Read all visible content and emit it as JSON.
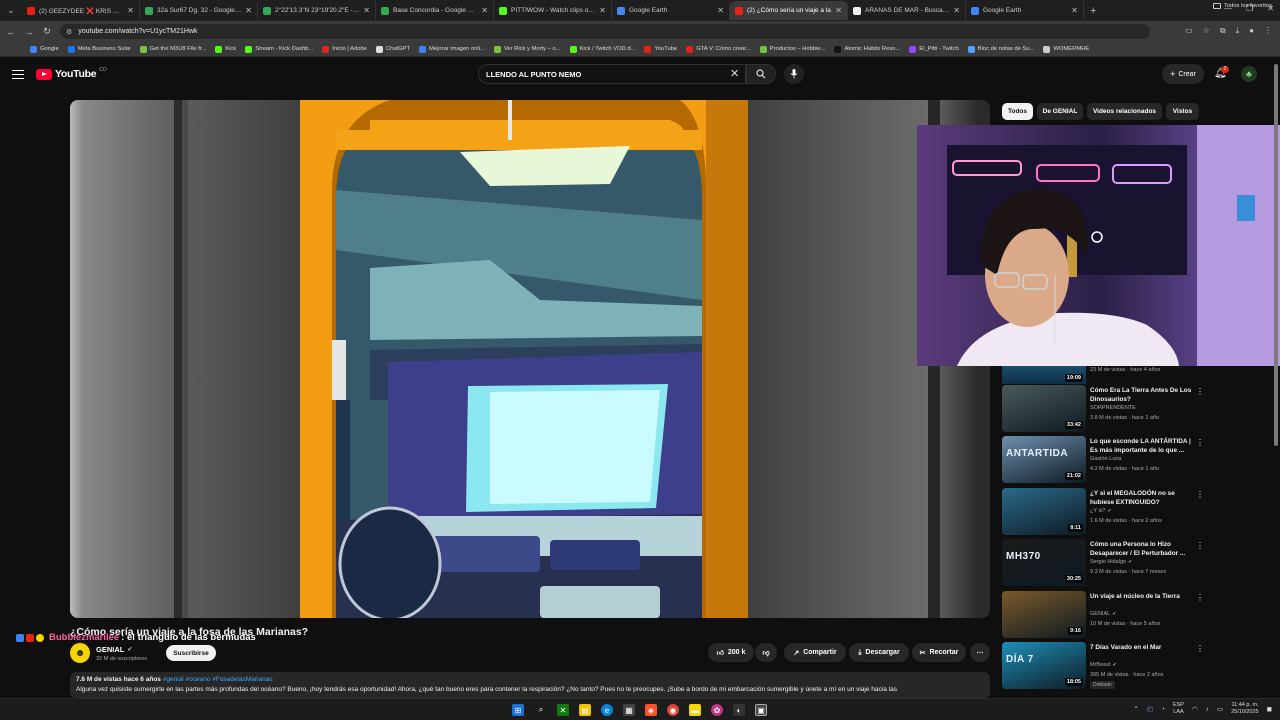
{
  "browser": {
    "tabs": [
      {
        "title": "(2) GEEZYDEE ❌ KRIS R - PAR",
        "color": "#e62117",
        "active": false
      },
      {
        "title": "32a Sur67 Dg. 32 - Google Ma",
        "color": "#34a853",
        "active": false
      },
      {
        "title": "2°22'13.3\"N 23°19'20.2\"E - Go",
        "color": "#34a853",
        "active": false
      },
      {
        "title": "Base Concordia - Google Maps",
        "color": "#34a853",
        "active": false
      },
      {
        "title": "PITTIWOW - Watch clips on Ki",
        "color": "#53fc18",
        "active": false
      },
      {
        "title": "Google Earth",
        "color": "#4285f4",
        "active": false
      },
      {
        "title": "(2) ¿Cómo sería un viaje a la",
        "color": "#e62117",
        "active": true
      },
      {
        "title": "ARAÑAS DE MAR - Buscar con",
        "color": "#eeeeee",
        "active": false
      },
      {
        "title": "Google Earth",
        "color": "#4285f4",
        "active": false
      }
    ],
    "url": "youtube.com/watch?v=U1ycTM21Hwk",
    "bookmarks": [
      {
        "label": "Google",
        "color": "#4285f4"
      },
      {
        "label": "Meta Business Suite",
        "color": "#1877f2"
      },
      {
        "label": "Get the M3U8 File fr...",
        "color": "#7cc242"
      },
      {
        "label": "Kick",
        "color": "#53fc18"
      },
      {
        "label": "Stream - Kick Dashb...",
        "color": "#53fc18"
      },
      {
        "label": "Inicio | Adobe",
        "color": "#e1251b"
      },
      {
        "label": "ChatGPT",
        "color": "#dddddd"
      },
      {
        "label": "Mejorar imagen onli...",
        "color": "#3b82f6"
      },
      {
        "label": "Ver Rick y Morty – o...",
        "color": "#7cc242"
      },
      {
        "label": "Kick / Twitch VOD d...",
        "color": "#53fc18"
      },
      {
        "label": "YouTube",
        "color": "#e62117"
      },
      {
        "label": "GTA V: Cómo crear...",
        "color": "#e62117"
      },
      {
        "label": "Productos – Hobbie...",
        "color": "#7cc242"
      },
      {
        "label": "Atomic Habits Reso...",
        "color": "#111111"
      },
      {
        "label": "El_Pitti - Twitch",
        "color": "#9146ff"
      },
      {
        "label": "Bloc de notas de Su...",
        "color": "#4da3ff"
      },
      {
        "label": "WOMERMHE",
        "color": "#cccccc"
      }
    ],
    "all_bookmarks": "Todos los favoritos"
  },
  "youtube": {
    "logo": "YouTube",
    "country": "CO",
    "search_query": "LLENDO AL PUNTO NEMO",
    "create_label": "Crear",
    "notifications": "2"
  },
  "video": {
    "title": "¿Cómo sería un viaje a la fosa de las Marianas?",
    "channel": "GENIAL",
    "subscribers": "32 M de suscriptores",
    "subscribe_label": "Suscribirse",
    "likes": "200 k",
    "share_label": "Compartir",
    "download_label": "Descargar",
    "clip_label": "Recortar",
    "views_date": "7.6 M de vistas  hace 6 años",
    "tags": "#genial #oceano #FosadelasMarianas",
    "description": "Alguna vez quisiste sumergirte en las partes más profundas del océano? Bueno, ¡hoy tendrás esa oportunidad! Ahora, ¿qué tan bueno eres para contener la respiración? ¿No tanto? Pues no te preocupes. ¡Sube a bordo de mi embarcación sumergible y únete a mí en un viaje hacia las"
  },
  "stream_overlay": {
    "username": "Bubblezmarilee",
    "message": ": el triangulo de las bermudas"
  },
  "filter_chips": [
    "Todos",
    "De GENIAL",
    "Videos relacionados",
    "Vistos"
  ],
  "recommendations_partial": {
    "duration": "19:09",
    "meta": "23 M de vistas · hace 4 años"
  },
  "recommendations": [
    {
      "title": "Cómo Era La Tierra Antes De Los Dinosaurios?",
      "channel": "SORPRENDENTE",
      "verified": false,
      "meta": "3.8 M de vistas · hace 1 año",
      "duration": "33:42",
      "thumb_color": "#4a5a5a",
      "thumb_label": "",
      "badge": ""
    },
    {
      "title": "Lo que esconde LA ANTÁRTIDA | Es más importante de lo que ...",
      "channel": "Gastón Luna",
      "verified": false,
      "meta": "4.2 M de vistas · hace 1 año",
      "duration": "21:02",
      "thumb_color": "#6e8fb0",
      "thumb_label": "ANTARTIDA",
      "badge": ""
    },
    {
      "title": "¿Y si el MEGALODÓN no se hubiese EXTINGUIDO?",
      "channel": "¿Y si?",
      "verified": true,
      "meta": "1.6 M de vistas · hace 2 años",
      "duration": "8:11",
      "thumb_color": "#2b6a8a",
      "thumb_label": "",
      "badge": ""
    },
    {
      "title": "Cómo una Persona lo Hizo Desaparecer / El Perturbador ...",
      "channel": "Sergio Hidalgo",
      "verified": true,
      "meta": "9.3 M de vistas · hace 7 meses",
      "duration": "30:25",
      "thumb_color": "#1a1a1a",
      "thumb_label": "MH370",
      "badge": ""
    },
    {
      "title": "Un viaje al núcleo de la Tierra",
      "channel": "GENIAL",
      "verified": true,
      "meta": "10 M de vistas · hace 5 años",
      "duration": "9:16",
      "thumb_color": "#7a5a2a",
      "thumb_label": "",
      "badge": ""
    },
    {
      "title": "7 Días Varado en el Mar",
      "channel": "MrBeast",
      "verified": true,
      "meta": "395 M de vistas · hace 2 años",
      "duration": "18:05",
      "thumb_color": "#1e8fb8",
      "thumb_label": "DÍA 7",
      "badge": "Doblado"
    }
  ],
  "taskbar": {
    "lang_top": "ESP",
    "lang_bottom": "LAA",
    "time": "11:44 p. m.",
    "date": "25/10/2025"
  }
}
